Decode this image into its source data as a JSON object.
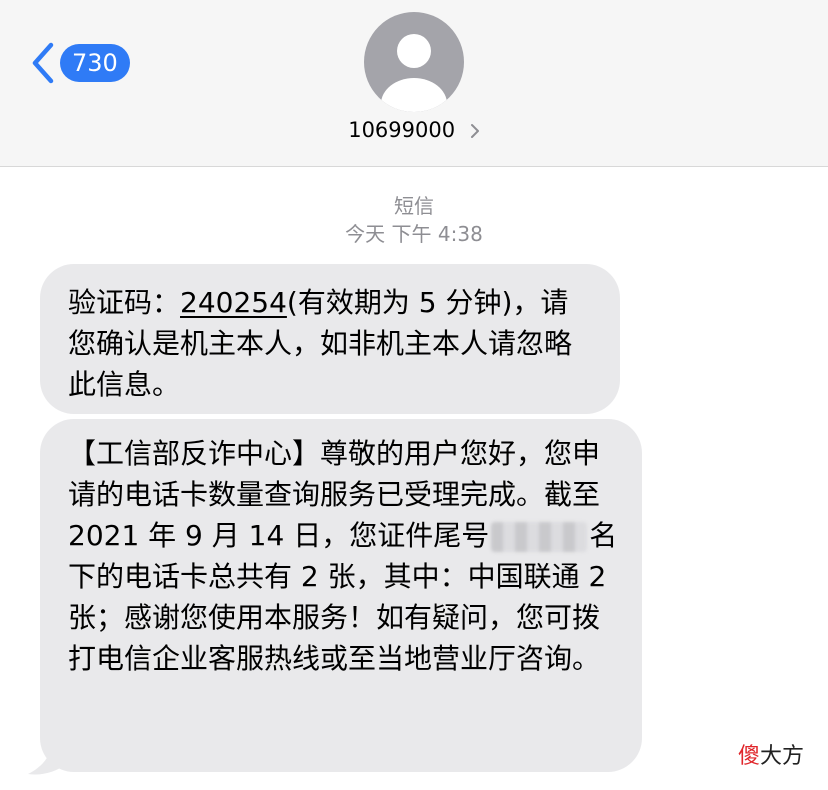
{
  "header": {
    "back_count": "730",
    "contact_name": "10699000"
  },
  "thread": {
    "service": "短信",
    "day": "今天",
    "time": "下午 4:38"
  },
  "messages": [
    {
      "before_code": "验证码：",
      "code": "240254",
      "after_code": "(有效期为 5 分钟)，请您确认是机主本人，如非机主本人请忽略此信息。"
    },
    {
      "before_redaction": "【工信部反诈中心】尊敬的用户您好，您申请的电话卡数量查询服务已受理完成。截至 2021 年 9 月 14 日，您证件尾号",
      "after_redaction": "名下的电话卡总共有 2 张，其中：中国联通 2 张；感谢您使用本服务！如有疑问，您可拨打电信企业客服热线或至当地营业厅咨询。"
    }
  ],
  "watermark": {
    "accent": "傻",
    "rest": "大方"
  },
  "colors": {
    "header_bg": "#f6f6f6",
    "accent_blue": "#2f7bf6",
    "bubble_bg": "#e9e9eb",
    "meta_gray": "#8e8e93",
    "avatar_gray": "#a4a4aa"
  },
  "icons": [
    "chevron-left-icon",
    "contact-avatar-icon",
    "chevron-right-icon"
  ]
}
